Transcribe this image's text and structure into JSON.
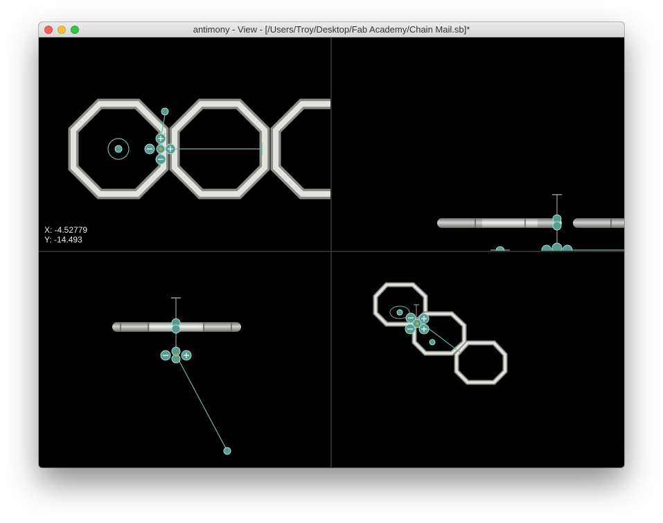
{
  "window": {
    "title": "antimony - View - [/Users/Troy/Desktop/Fab Academy/Chain Mail.sb]*"
  },
  "viewport": {
    "cursor_x": "X: -4.52779",
    "cursor_y": "Y: -14.493"
  },
  "colors": {
    "background": "#000000",
    "divider": "#3a3a3a",
    "handle": "#5a9a90",
    "handle_stroke": "#a8e0d4",
    "ring": "#d6d8d2"
  },
  "icons": {
    "close": "close-icon",
    "minimize": "minimize-icon",
    "maximize": "maximize-icon",
    "plus": "plus-icon",
    "minus": "minus-icon"
  }
}
